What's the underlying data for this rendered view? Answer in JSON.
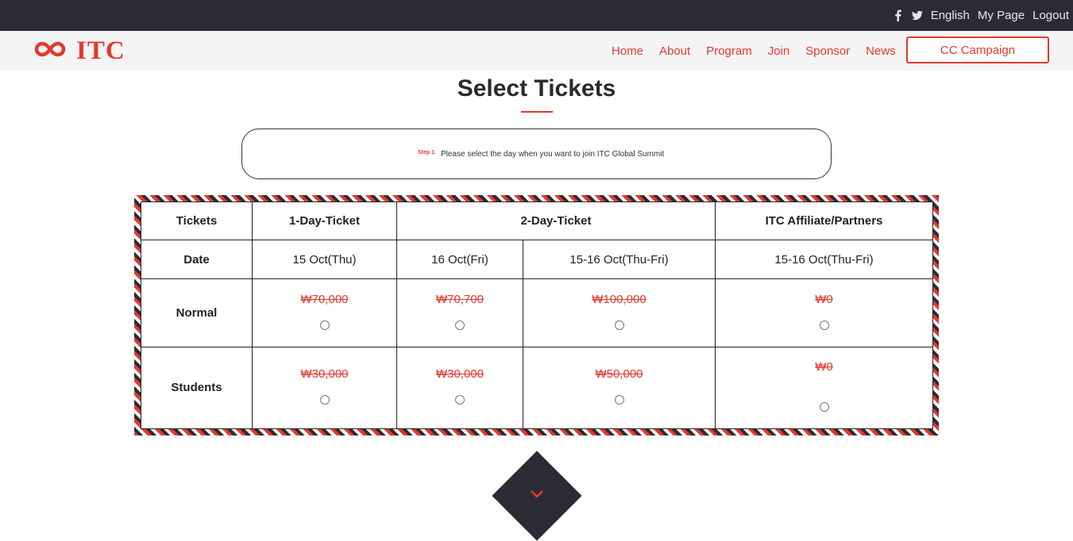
{
  "topbar": {
    "facebook_icon": "facebook-icon",
    "twitter_icon": "twitter-icon",
    "language": "English",
    "mypage": "My Page",
    "logout": "Logout"
  },
  "header": {
    "logo_text": "ITC",
    "nav": [
      "Home",
      "About",
      "Program",
      "Join",
      "Sponsor",
      "News"
    ],
    "cta": "CC Campaign"
  },
  "page": {
    "title": "Select Tickets",
    "step_label": "Step 1",
    "step_text": "Please select the day when you want to join ITC Global Summit"
  },
  "table": {
    "headers": [
      "Tickets",
      "1-Day-Ticket",
      "2-Day-Ticket",
      "ITC Affiliate/Partners"
    ],
    "date_label": "Date",
    "dates": [
      "15 Oct(Thu)",
      "16 Oct(Fri)",
      "15-16 Oct(Thu-Fri)",
      "15-16 Oct(Thu-Fri)"
    ],
    "rows": [
      {
        "label": "Normal",
        "prices": [
          "₩70,000",
          "₩70,700",
          "₩100,000",
          "₩0"
        ]
      },
      {
        "label": "Students",
        "prices": [
          "₩30,000",
          "₩30,000",
          "₩50,000",
          "₩0"
        ]
      }
    ]
  },
  "colors": {
    "accent": "#e23a2e",
    "dark": "#2b2b35"
  }
}
